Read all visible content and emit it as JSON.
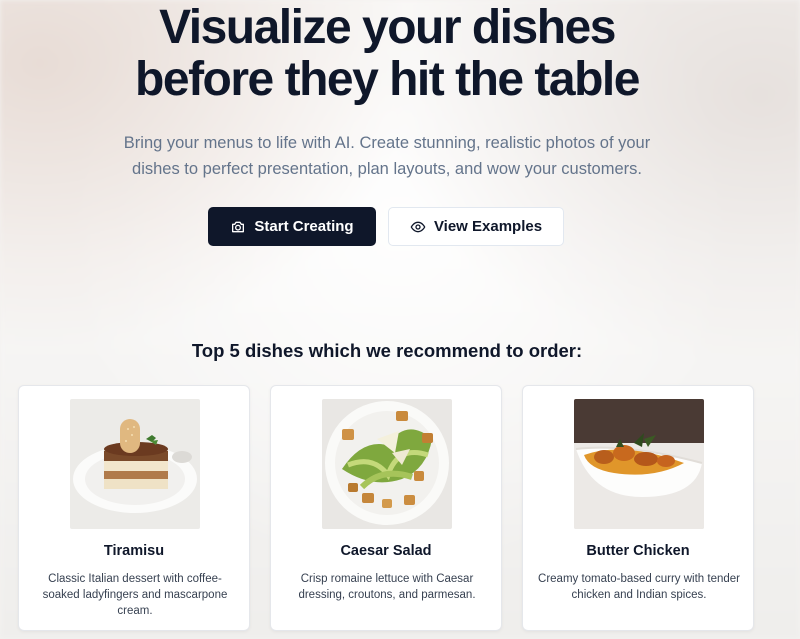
{
  "hero": {
    "title_line1": "Visualize your dishes",
    "title_line2": "before they hit the table",
    "subtitle_line1": "Bring your menus to life with AI. Create stunning, realistic photos of your",
    "subtitle_line2": "dishes to perfect presentation, plan layouts, and wow your customers."
  },
  "buttons": {
    "start_label": "Start Creating",
    "start_icon": "camera-icon",
    "examples_label": "View Examples",
    "examples_icon": "eye-icon"
  },
  "section": {
    "title": "Top 5 dishes which we recommend to order:"
  },
  "dishes": [
    {
      "name": "Tiramisu",
      "description": "Classic Italian dessert with coffee-soaked ladyfingers and mascarpone cream.",
      "image": "tiramisu-photo"
    },
    {
      "name": "Caesar Salad",
      "description": "Crisp romaine lettuce with Caesar dressing, croutons, and parmesan.",
      "image": "caesar-salad-photo"
    },
    {
      "name": "Butter Chicken",
      "description": "Creamy tomato-based curry with tender chicken and Indian spices.",
      "image": "butter-chicken-photo"
    }
  ],
  "colors": {
    "primary": "#0f172a",
    "muted_text": "#64748b",
    "card_border": "#e5e7eb"
  }
}
